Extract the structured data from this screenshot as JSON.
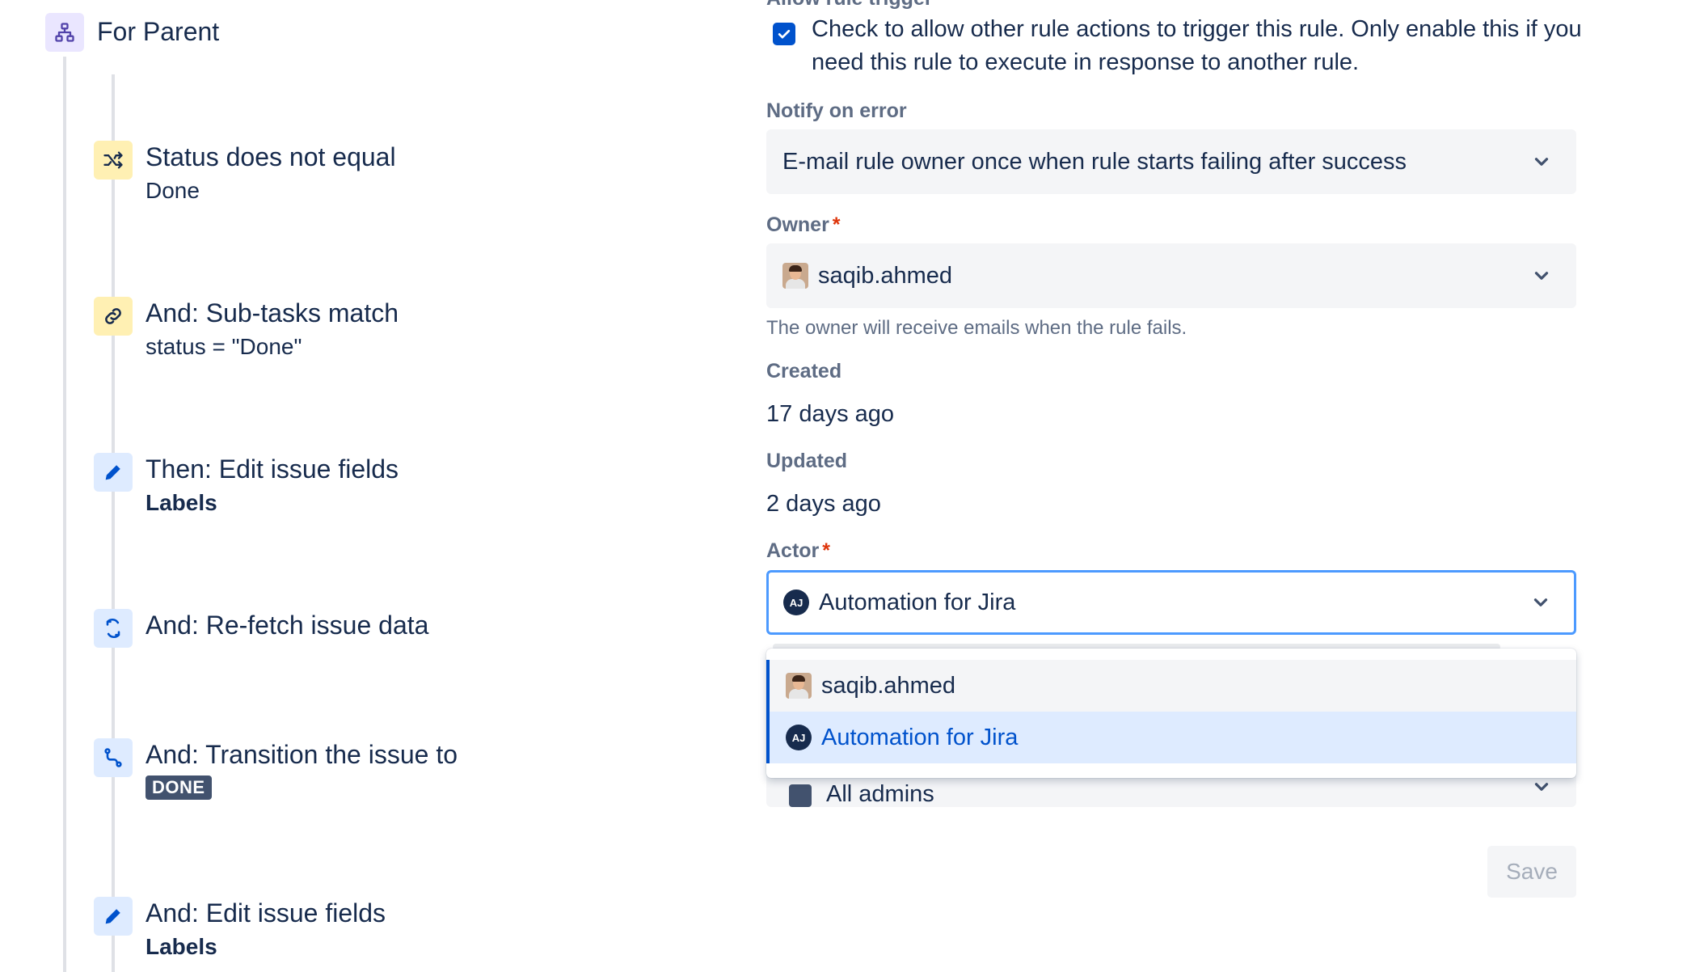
{
  "flow": {
    "branch": {
      "title": "For Parent"
    },
    "nodes": [
      {
        "title": "Status does not equal",
        "subtitle": "Done"
      },
      {
        "title": "And: Sub-tasks match",
        "subtitle": "status = \"Done\""
      },
      {
        "title": "Then: Edit issue fields",
        "subtitle": "Labels"
      },
      {
        "title": "And: Re-fetch issue data"
      },
      {
        "title": "And: Transition the issue to",
        "lozenge": "DONE"
      },
      {
        "title": "And: Edit issue fields",
        "subtitle": "Labels"
      }
    ]
  },
  "details": {
    "allow_trigger": {
      "label": "Allow rule trigger",
      "checked": true,
      "text": "Check to allow other rule actions to trigger this rule. Only enable this if you need this rule to execute in response to another rule."
    },
    "notify": {
      "label": "Notify on error",
      "value": "E-mail rule owner once when rule starts failing after success"
    },
    "owner": {
      "label": "Owner",
      "required_mark": "*",
      "value": "saqib.ahmed",
      "helper": "The owner will receive emails when the rule fails."
    },
    "created": {
      "label": "Created",
      "value": "17 days ago"
    },
    "updated": {
      "label": "Updated",
      "value": "2 days ago"
    },
    "actor": {
      "label": "Actor",
      "required_mark": "*",
      "value": "Automation for Jira",
      "avatar_initials": "AJ",
      "options": [
        {
          "label": "saqib.ahmed"
        },
        {
          "label": "Automation for Jira",
          "avatar_initials": "AJ"
        }
      ]
    },
    "scope_peek": {
      "value": "All admins"
    },
    "save_label": "Save"
  },
  "colors": {
    "primary": "#0052cc",
    "focus_border": "#4c9aff",
    "selected_bg": "#deebff",
    "required": "#de350b",
    "lozenge_bg": "#42526e"
  }
}
